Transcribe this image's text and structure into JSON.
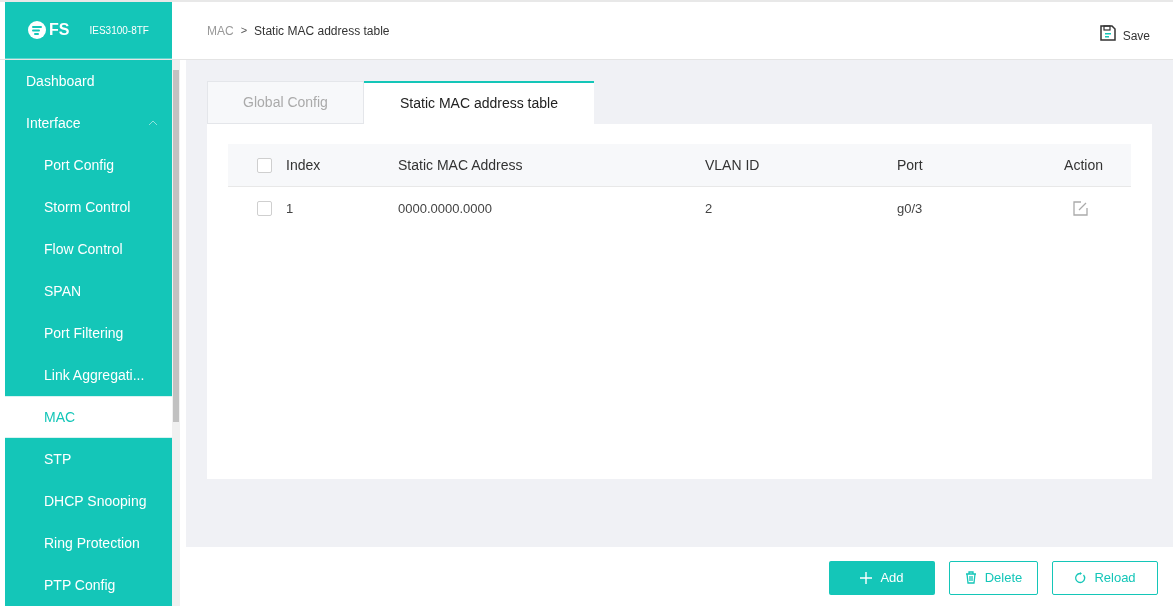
{
  "header": {
    "logo": "FS",
    "model": "IES3100-8TF",
    "breadcrumb": [
      "MAC",
      "Static MAC address table"
    ],
    "breadcrumb_separator": ">",
    "save": "Save"
  },
  "sidebar": {
    "items": [
      {
        "label": "Dashboard",
        "selected": false
      },
      {
        "label": "Interface",
        "selected": false,
        "expanded": true,
        "children": [
          {
            "label": "Port Config",
            "selected": false
          },
          {
            "label": "Storm Control",
            "selected": false
          },
          {
            "label": "Flow Control",
            "selected": false
          },
          {
            "label": "SPAN",
            "selected": false
          },
          {
            "label": "Port Filtering",
            "selected": false
          },
          {
            "label": "Link Aggregati...",
            "selected": false
          },
          {
            "label": "MAC",
            "selected": true
          },
          {
            "label": "STP",
            "selected": false
          },
          {
            "label": "DHCP Snooping",
            "selected": false
          },
          {
            "label": "Ring Protection",
            "selected": false
          },
          {
            "label": "PTP Config",
            "selected": false
          }
        ]
      }
    ]
  },
  "tabs": [
    {
      "label": "Global Config",
      "selected": false
    },
    {
      "label": "Static MAC address table",
      "selected": true
    }
  ],
  "table": {
    "select_all_checked": false,
    "columns": [
      "Index",
      "Static MAC Address",
      "VLAN ID",
      "Port",
      "Action"
    ],
    "rows": [
      {
        "checked": false,
        "cells": [
          "1",
          "0000.0000.0000",
          "2",
          "g0/3"
        ]
      }
    ]
  },
  "buttons": [
    {
      "label": "Add",
      "kind": "add"
    },
    {
      "label": "Delete",
      "kind": "delete"
    },
    {
      "label": "Reload",
      "kind": "reload"
    }
  ]
}
